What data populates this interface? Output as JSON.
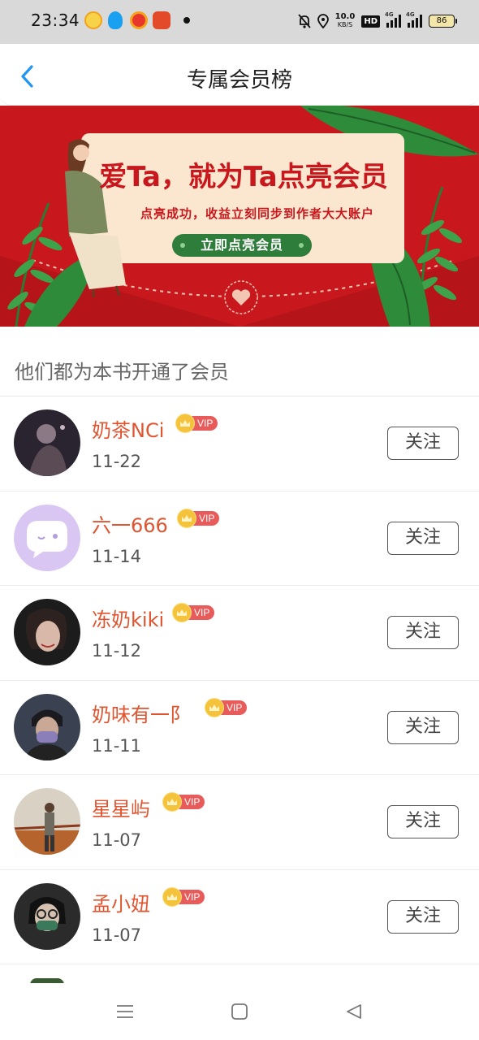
{
  "status_bar": {
    "time": "23:34",
    "net_speed_value": "10.0",
    "net_speed_unit": "KB/S",
    "hd_badge": "HD",
    "sim1_label": "4G",
    "sim2_label": "4G",
    "battery": "86",
    "app_icons": [
      "emoji-face-icon",
      "qq-penguin-icon",
      "weibo-icon",
      "app-red-icon"
    ]
  },
  "header": {
    "title": "专属会员榜",
    "back_icon": "chevron-left-icon"
  },
  "banner": {
    "headline": "爱Ta，就为Ta点亮会员",
    "subtitle": "点亮成功，收益立刻同步到作者大大账户",
    "button_label": "立即点亮会员"
  },
  "section": {
    "title": "他们都为本书开通了会员"
  },
  "vip_label": "VIP",
  "follow_label": "关注",
  "members": [
    {
      "name": "奶茶NCi",
      "date": "11-22"
    },
    {
      "name": "六一666",
      "date": "11-14"
    },
    {
      "name": "冻奶kiki",
      "date": "11-12"
    },
    {
      "name": "奶味有一阝",
      "date": "11-11"
    },
    {
      "name": "星星屿",
      "date": "11-07"
    },
    {
      "name": "孟小妞",
      "date": "11-07"
    }
  ],
  "nav": {
    "icons": [
      "menu-icon",
      "home-square-icon",
      "back-triangle-icon"
    ]
  },
  "colors": {
    "accent": "#e0542f",
    "back_arrow": "#2196f3",
    "banner_red": "#c8181e",
    "vip_tag": "#e85b5b",
    "crown": "#f5c33b"
  }
}
